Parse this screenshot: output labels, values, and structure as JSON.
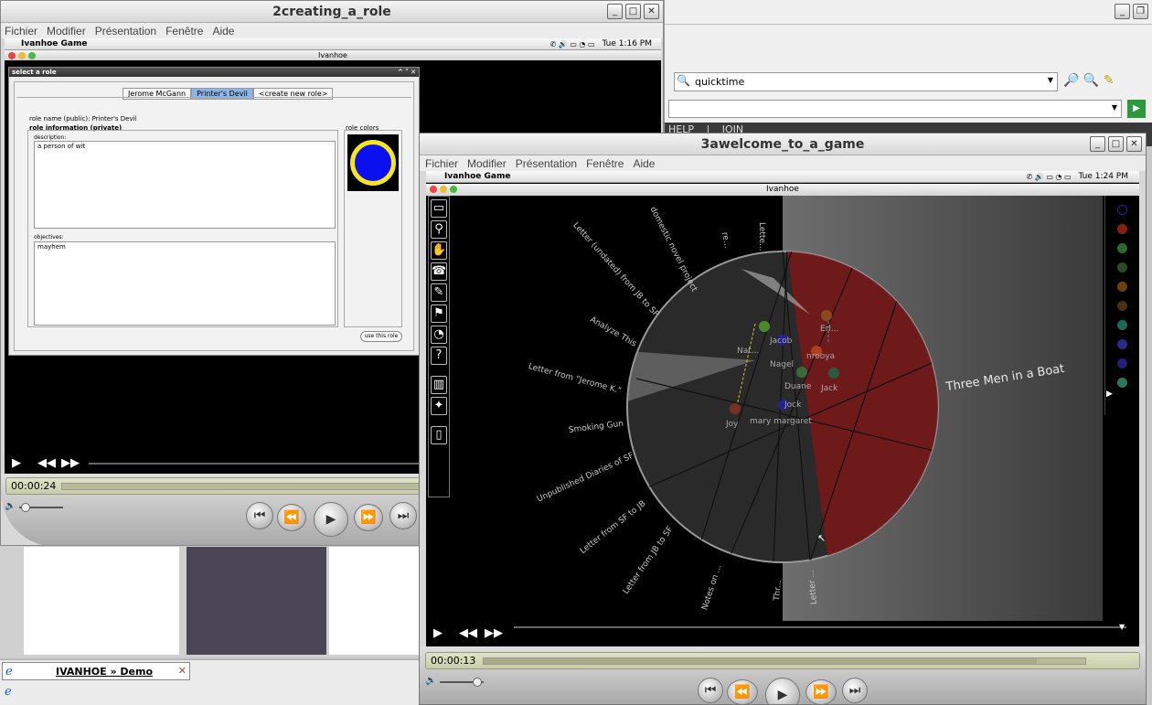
{
  "win1": {
    "title": "2creating_a_role",
    "menu": [
      "Fichier",
      "Modifier",
      "Présentation",
      "Fenêtre",
      "Aide"
    ],
    "mac_app": "Ivanhoe Game",
    "mac_clock": "Tue 1:16 PM",
    "inner_title": "Ivanhoe",
    "time": "00:00:24"
  },
  "dialog": {
    "title": "select a role",
    "tabs": [
      "Jerome McGann",
      "Printer's Devil",
      "<create new role>"
    ],
    "role_name": "role name (public): Printer's Devil",
    "role_info_label": "role information (private)",
    "role_colors_label": "role colors",
    "description_label": "description:",
    "description_value": "a person of wit",
    "objectives_label": "objectives:",
    "objectives_value": "mayhem",
    "use_button": "use this role"
  },
  "browser": {
    "search_value": "quicktime",
    "nav_help": "HELP",
    "nav_join": "JOIN",
    "tab1_label": "IVANHOE » Demo"
  },
  "win2": {
    "title": "3awelcome_to_a_game",
    "menu": [
      "Fichier",
      "Modifier",
      "Présentation",
      "Fenêtre",
      "Aide"
    ],
    "mac_app": "Ivanhoe Game",
    "mac_clock": "Tue 1:24 PM",
    "inner_title": "Ivanhoe",
    "time": "00:00:13",
    "progress": 0.92
  },
  "game": {
    "center_label": "Three Men in a Boat",
    "radial_labels": [
      "Letter (undated) from JB to SF",
      "domestic novel project",
      "re...",
      "Lette...",
      "Analyze This",
      "Letter from \"Jerome K.\"",
      "Smoking Gun",
      "Unpublished Diaries of SF",
      "Letter from SF to JB",
      "Letter from JB to SF",
      "Notes on ...",
      "Thr...",
      "Letter ..."
    ],
    "nodes": [
      "Jacob",
      "Nat...",
      "Nagel",
      "nrooya",
      "Duane",
      "Jack",
      "Joy",
      "Erl...",
      "Jock",
      "mary margaret"
    ],
    "palette_colors": [
      "#1a2a8a",
      "#8a2010",
      "#2a6a2a",
      "#2a4a2a",
      "#6a4010",
      "#4a3010",
      "#1a6a5a",
      "#2a2a8a",
      "#20207a",
      "#2a7a5a"
    ]
  },
  "colors": {
    "role_ring": "#f6e61a",
    "role_fill": "#0a10f0",
    "red_region": "#8a1a1a"
  }
}
